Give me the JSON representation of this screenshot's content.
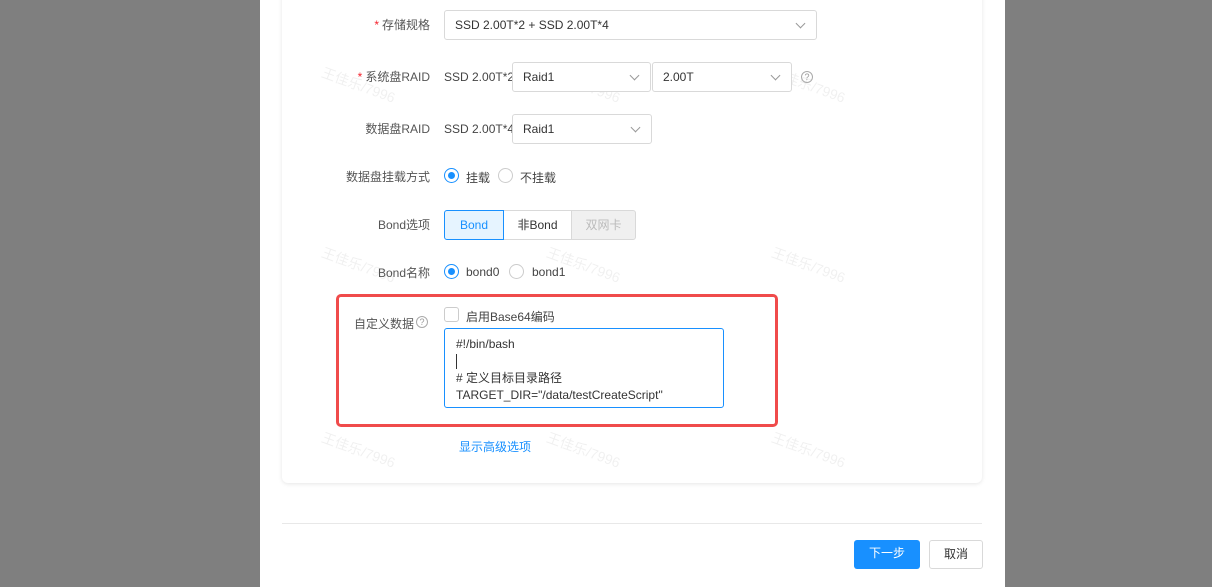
{
  "form": {
    "storage_spec": {
      "label": "存储规格",
      "value": "SSD 2.00T*2 + SSD 2.00T*4"
    },
    "system_raid": {
      "label": "系统盘RAID",
      "disk": "SSD 2.00T*2",
      "raid": "Raid1",
      "size": "2.00T"
    },
    "data_raid": {
      "label": "数据盘RAID",
      "disk": "SSD 2.00T*4",
      "raid": "Raid1"
    },
    "mount_mode": {
      "label": "数据盘挂载方式",
      "options": [
        "挂载",
        "不挂载"
      ],
      "selected": "挂载"
    },
    "bond_option": {
      "label": "Bond选项",
      "options": [
        "Bond",
        "非Bond",
        "双网卡"
      ],
      "selected": "Bond",
      "disabled": "双网卡"
    },
    "bond_name": {
      "label": "Bond名称",
      "options": [
        "bond0",
        "bond1"
      ],
      "selected": "bond0"
    },
    "custom_data": {
      "label": "自定义数据",
      "base64_label": "启用Base64编码",
      "base64_checked": false,
      "lines": [
        "#!/bin/bash",
        "",
        "# 定义目标目录路径",
        "TARGET_DIR=\"/data/testCreateScript\""
      ]
    },
    "advanced_link": "显示高级选项"
  },
  "footer": {
    "next": "下一步",
    "cancel": "取消"
  },
  "watermark": "王佳乐/7996",
  "colors": {
    "primary": "#1890ff",
    "highlight": "#f04b4b",
    "required": "#f5222d"
  }
}
